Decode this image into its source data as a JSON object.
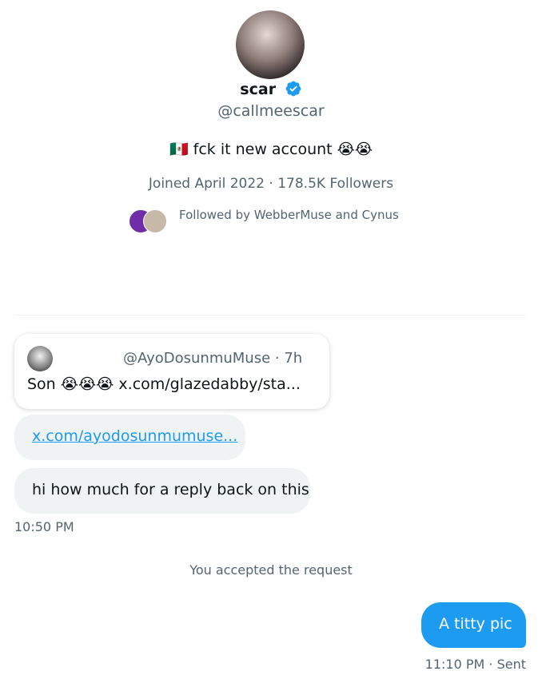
{
  "profile": {
    "name": "scar",
    "handle": "@callmeescar",
    "bio": "🇲🇽 fck it new account 😭😭",
    "joined": "Joined April 2022",
    "separator": "·",
    "followers": "178.5K Followers",
    "followed_by": "Followed by WebberMuse and Cynus"
  },
  "quote": {
    "handle_time": "@AyoDosunmuMuse · 7h",
    "text": "Son 😭😭😭 x.com/glazedabby/sta..."
  },
  "messages": {
    "link": "x.com/ayodosunmumuse...",
    "incoming_text": "hi how much for a reply back on this",
    "incoming_time": "10:50 PM",
    "accepted_notice": "You accepted the request",
    "outgoing_text": "A titty pic",
    "outgoing_time": "11:10 PM",
    "outgoing_dot": "·",
    "outgoing_status": "Sent"
  },
  "colors": {
    "accent": "#1d9bf0",
    "muted": "#536471",
    "bubble_in": "#eff3f4"
  },
  "icons": [
    "verified-badge-icon"
  ]
}
